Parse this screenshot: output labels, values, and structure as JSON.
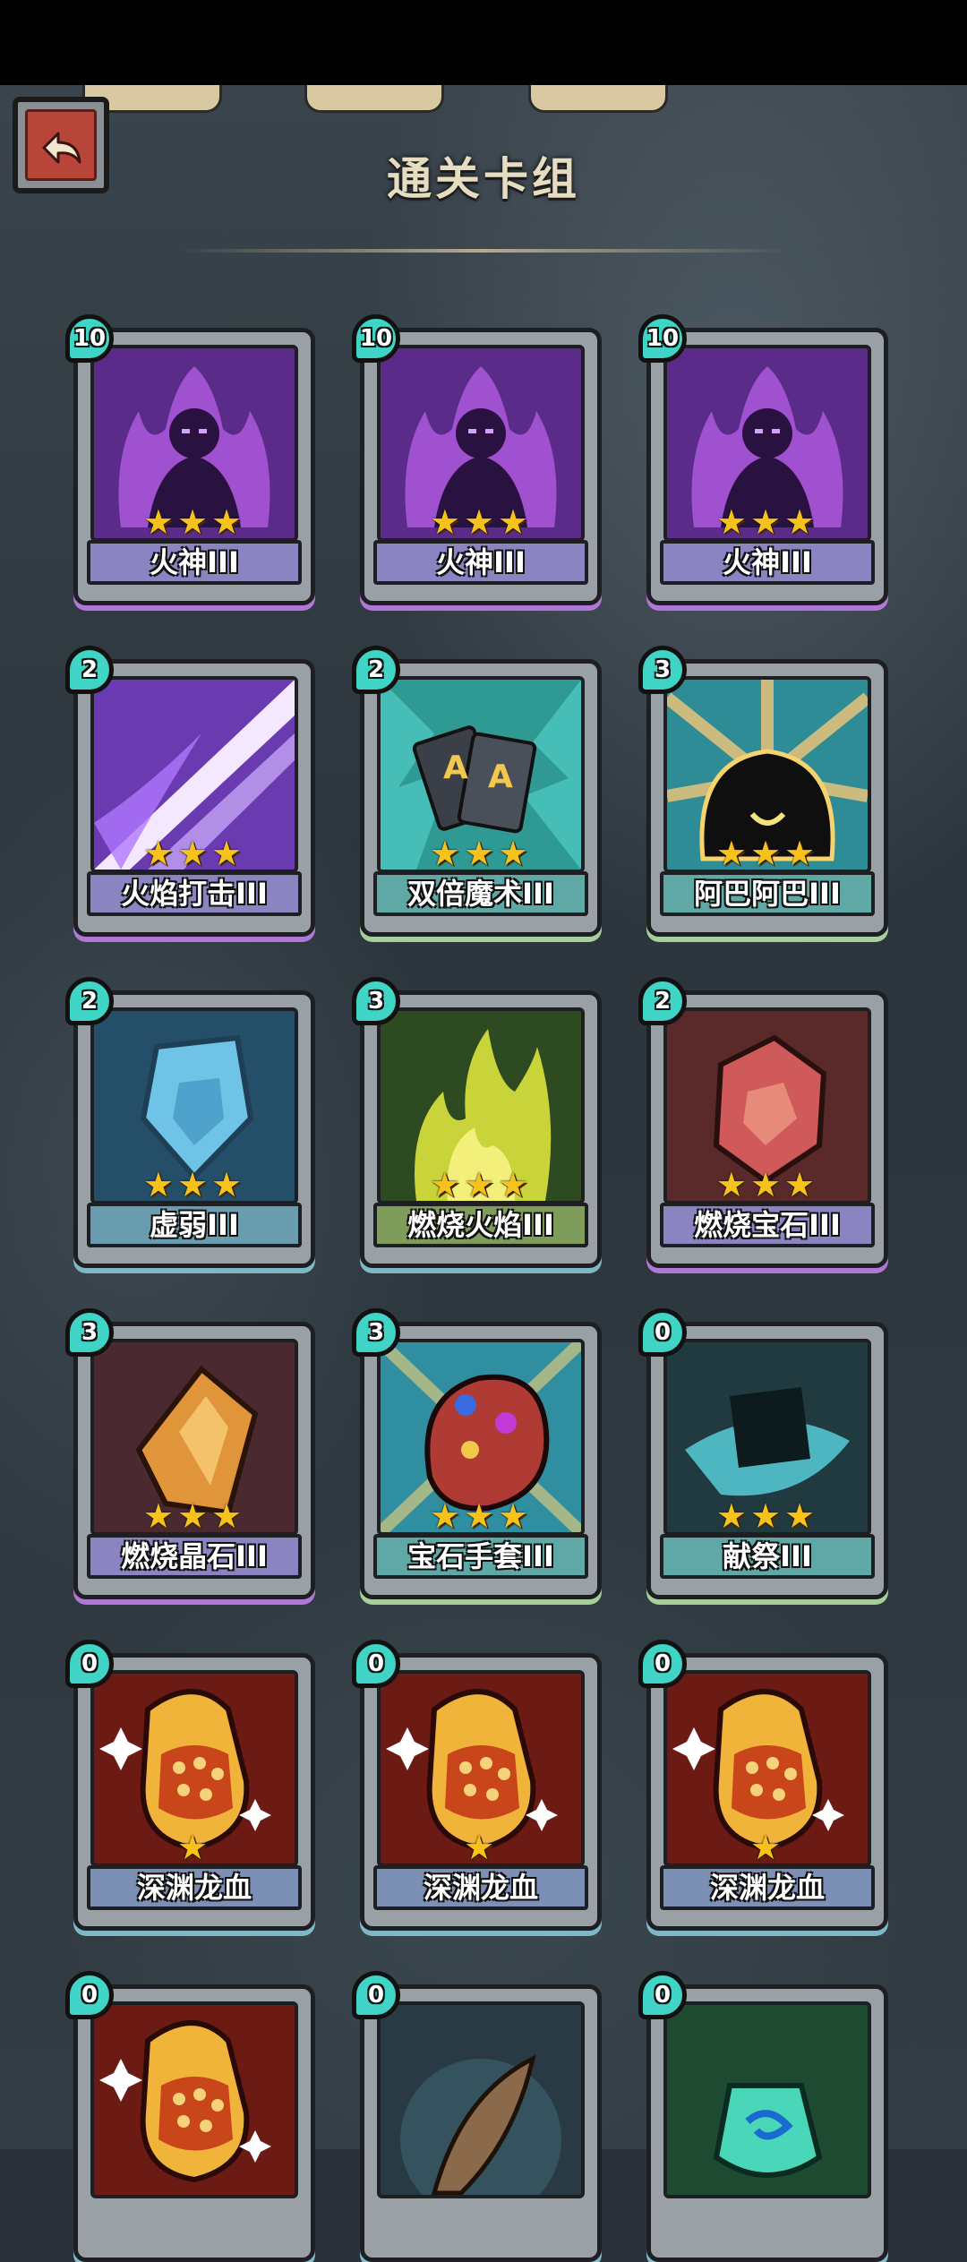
{
  "header": {
    "title": "通关卡组"
  },
  "cards": [
    {
      "name": "火神III",
      "cost": "10",
      "stars": "★★★",
      "icon": "fire-god",
      "art": "#5b2b8a",
      "label_bg": "#8a84c0"
    },
    {
      "name": "火神III",
      "cost": "10",
      "stars": "★★★",
      "icon": "fire-god",
      "art": "#5b2b8a",
      "label_bg": "#8a84c0"
    },
    {
      "name": "火神III",
      "cost": "10",
      "stars": "★★★",
      "icon": "fire-god",
      "art": "#5b2b8a",
      "label_bg": "#8a84c0"
    },
    {
      "name": "火焰打击III",
      "cost": "2",
      "stars": "★★★",
      "icon": "flame-strike",
      "art": "#6a3bb0",
      "label_bg": "#8a84c0"
    },
    {
      "name": "双倍魔术III",
      "cost": "2",
      "stars": "★★★",
      "icon": "double-magic-cards",
      "art": "#2f9a94",
      "label_bg": "#5fa8a6"
    },
    {
      "name": "阿巴阿巴III",
      "cost": "3",
      "stars": "★★★",
      "icon": "abba-blob",
      "art": "#2e8c96",
      "label_bg": "#5fa8a6"
    },
    {
      "name": "虚弱III",
      "cost": "2",
      "stars": "★★★",
      "icon": "weak-shield",
      "art": "#254e68",
      "label_bg": "#6a9cb0"
    },
    {
      "name": "燃烧火焰III",
      "cost": "3",
      "stars": "★★★",
      "icon": "burning-flame",
      "art": "#2d4a20",
      "label_bg": "#7f9c5a"
    },
    {
      "name": "燃烧宝石III",
      "cost": "2",
      "stars": "★★★",
      "icon": "burning-gem",
      "art": "#5a2a2a",
      "label_bg": "#8a84c0"
    },
    {
      "name": "燃烧晶石III",
      "cost": "3",
      "stars": "★★★",
      "icon": "burning-crystal",
      "art": "#4a2a30",
      "label_bg": "#8a84c0"
    },
    {
      "name": "宝石手套III",
      "cost": "3",
      "stars": "★★★",
      "icon": "gem-gauntlet",
      "art": "#2f8ea0",
      "label_bg": "#5fa8a6"
    },
    {
      "name": "献祭III",
      "cost": "0",
      "stars": "★★★",
      "icon": "sacrifice",
      "art": "#203a40",
      "label_bg": "#5fa8a6"
    },
    {
      "name": "深渊龙血",
      "cost": "0",
      "stars": "★",
      "icon": "abyss-dragon-blood",
      "art": "#6b1a14",
      "label_bg": "#7c90b5"
    },
    {
      "name": "深渊龙血",
      "cost": "0",
      "stars": "★",
      "icon": "abyss-dragon-blood",
      "art": "#6b1a14",
      "label_bg": "#7c90b5"
    },
    {
      "name": "深渊龙血",
      "cost": "0",
      "stars": "★",
      "icon": "abyss-dragon-blood",
      "art": "#6b1a14",
      "label_bg": "#7c90b5"
    },
    {
      "name": "",
      "cost": "0",
      "stars": "",
      "icon": "abyss-dragon-blood",
      "art": "#6b1a14",
      "label_bg": "#7c90b5"
    },
    {
      "name": "",
      "cost": "0",
      "stars": "",
      "icon": "feather",
      "art": "#2a3a44",
      "label_bg": "#7c90b5"
    },
    {
      "name": "",
      "cost": "0",
      "stars": "",
      "icon": "swirl-potion",
      "art": "#1d4a30",
      "label_bg": "#5fa8a6"
    }
  ]
}
